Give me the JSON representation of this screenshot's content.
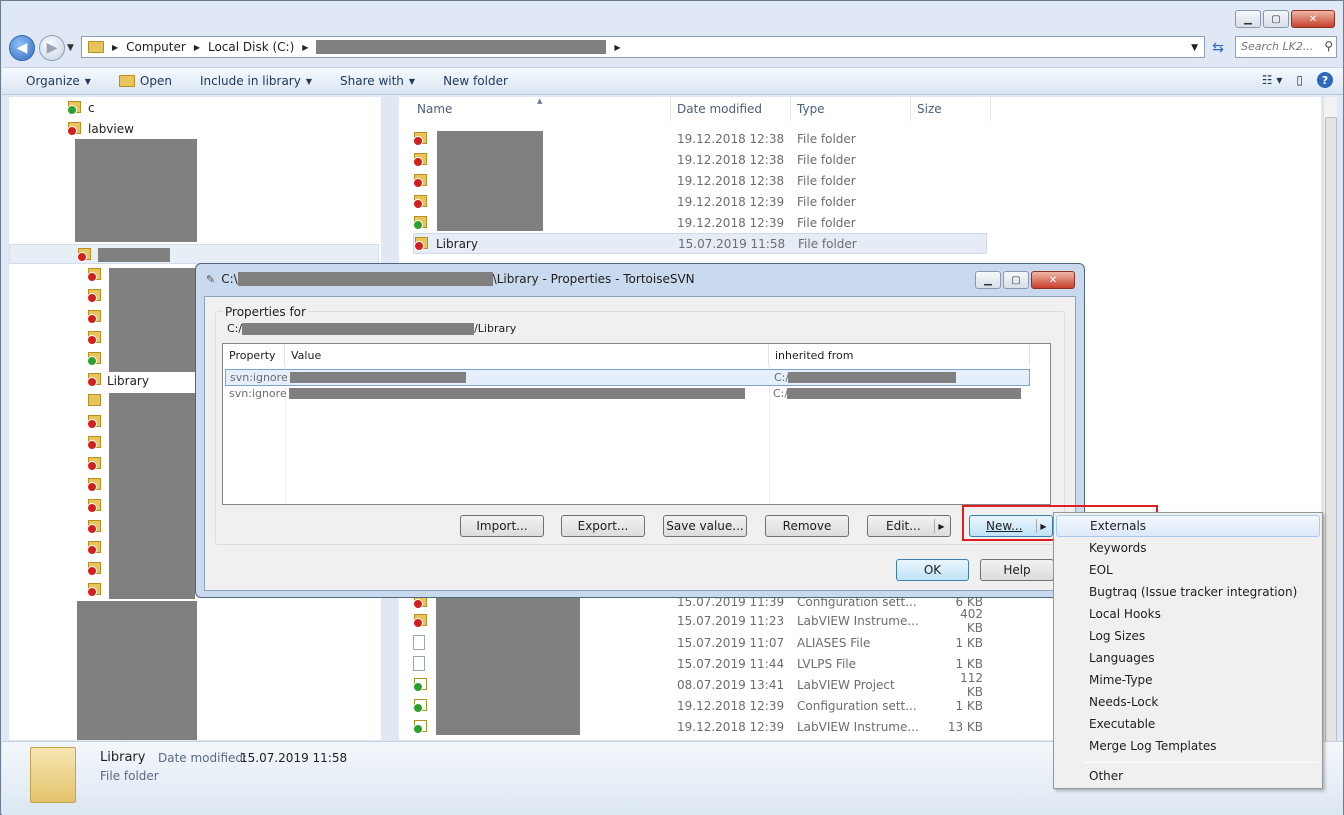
{
  "explorer": {
    "breadcrumb": [
      "Computer",
      "Local Disk (C:)"
    ],
    "search_placeholder": "Search LK2...",
    "toolbar": {
      "organize": "Organize",
      "open": "Open",
      "include": "Include in library",
      "share": "Share with",
      "new_folder": "New folder"
    },
    "tree": {
      "item_c": "c",
      "item_labview": "labview",
      "item_library": "Library"
    },
    "columns": {
      "name": "Name",
      "date": "Date modified",
      "type": "Type",
      "size": "Size"
    },
    "files_top": [
      {
        "name": "",
        "date": "19.12.2018 12:38",
        "type": "File folder",
        "size": ""
      },
      {
        "name": "",
        "date": "19.12.2018 12:38",
        "type": "File folder",
        "size": ""
      },
      {
        "name": "",
        "date": "19.12.2018 12:38",
        "type": "File folder",
        "size": ""
      },
      {
        "name": "",
        "date": "19.12.2018 12:39",
        "type": "File folder",
        "size": ""
      },
      {
        "name": "",
        "date": "19.12.2018 12:39",
        "type": "File folder",
        "size": ""
      },
      {
        "name": "Library",
        "date": "15.07.2019 11:58",
        "type": "File folder",
        "size": ""
      }
    ],
    "files_bottom": [
      {
        "date": "15.07.2019 11:39",
        "type": "Configuration sett...",
        "size": "6 KB"
      },
      {
        "date": "15.07.2019 11:23",
        "type": "LabVIEW Instrume...",
        "size": "402 KB"
      },
      {
        "date": "15.07.2019 11:07",
        "type": "ALIASES File",
        "size": "1 KB"
      },
      {
        "date": "15.07.2019 11:44",
        "type": "LVLPS File",
        "size": "1 KB"
      },
      {
        "date": "08.07.2019 13:41",
        "type": "LabVIEW Project",
        "size": "112 KB"
      },
      {
        "date": "19.12.2018 12:39",
        "type": "Configuration sett...",
        "size": "1 KB"
      },
      {
        "date": "19.12.2018 12:39",
        "type": "LabVIEW Instrume...",
        "size": "13 KB"
      }
    ],
    "details": {
      "name": "Library",
      "date_label": "Date modified:",
      "date_value": "15.07.2019 11:58",
      "type": "File folder"
    }
  },
  "dialog": {
    "title_prefix": "C:\\",
    "title_suffix": "\\Library - Properties - TortoiseSVN",
    "group_label": "Properties for",
    "path_prefix": "C:/",
    "path_suffix": "/Library",
    "columns": {
      "property": "Property",
      "value": "Value",
      "inherited": "inherited from"
    },
    "rows": [
      {
        "property": "svn:ignore",
        "inherited_prefix": "C:/"
      },
      {
        "property": "svn:ignore",
        "inherited_prefix": "C:/"
      }
    ],
    "buttons": {
      "import": "Import...",
      "export": "Export...",
      "save_value": "Save value...",
      "remove": "Remove",
      "edit": "Edit...",
      "new": "New...",
      "ok": "OK",
      "help": "Help"
    }
  },
  "menu": {
    "items": [
      "Externals",
      "Keywords",
      "EOL",
      "Bugtraq (Issue tracker integration)",
      "Local Hooks",
      "Log Sizes",
      "Languages",
      "Mime-Type",
      "Needs-Lock",
      "Executable",
      "Merge Log Templates"
    ],
    "last": "Other"
  }
}
